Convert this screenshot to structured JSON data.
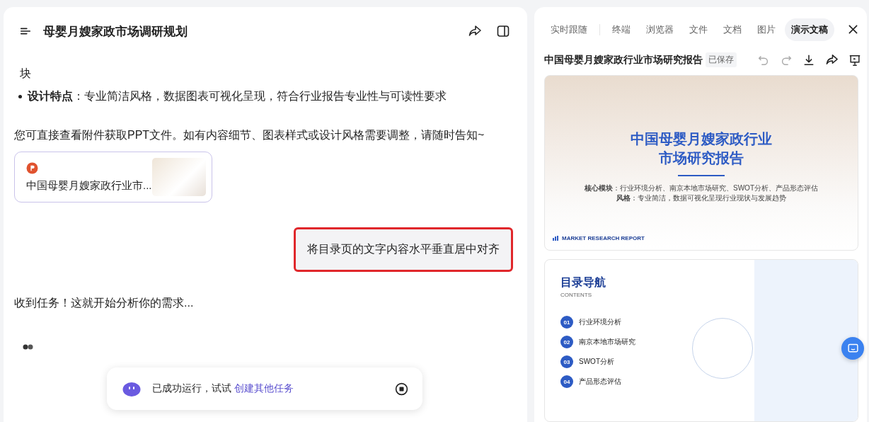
{
  "chat": {
    "title": "母婴月嫂家政市场调研规划",
    "bullets": [
      {
        "kind": "continuation",
        "text": "块"
      },
      {
        "kind": "bullet",
        "text": "**设计特点**：专业简洁风格，数据图表可视化呈现，符合行业报告专业性与可读性要求"
      }
    ],
    "message": "您可直接查看附件获取PPT文件。如有内容细节、图表样式或设计风格需要调整，请随时告知~",
    "attachment": {
      "name": "中国母婴月嫂家政行业市..."
    },
    "user_message": {
      "text": "将目录页的文字内容水平垂直居中对齐",
      "highlighted": true
    },
    "reply": "收到任务！这就开始分析你的需求...",
    "status": {
      "text": "已成功运行，试试",
      "link": "创建其他任务"
    }
  },
  "panel": {
    "tabs": [
      {
        "label": "实时跟随",
        "selected": false
      },
      {
        "label": "终端",
        "selected": false
      },
      {
        "label": "浏览器",
        "selected": false
      },
      {
        "label": "文件",
        "selected": false
      },
      {
        "label": "文档",
        "selected": false
      },
      {
        "label": "图片",
        "selected": false
      },
      {
        "label": "演示文稿",
        "selected": true
      }
    ],
    "doc_title": "中国母婴月嫂家政行业市场研究报告",
    "saved": "已保存",
    "slides": [
      {
        "kind": "cover",
        "title_lines": [
          "中国母婴月嫂家政行业",
          "市场研究报告"
        ],
        "lines": [
          "**核心模块**：行业环境分析、南京本地市场研究、SWOT分析、产品形态评估",
          "**风格**：专业简洁，数据可视化呈现行业现状与发展趋势"
        ],
        "footer": "MARKET RESEARCH REPORT"
      },
      {
        "kind": "contents",
        "title": "目录导航",
        "subtitle": "CONTENTS",
        "items": [
          {
            "number": "01",
            "text": "行业环境分析"
          },
          {
            "number": "02",
            "text": "南京本地市场研究"
          },
          {
            "number": "03",
            "text": "SWOT分析"
          },
          {
            "number": "04",
            "text": "产品形态评估"
          }
        ]
      }
    ]
  }
}
